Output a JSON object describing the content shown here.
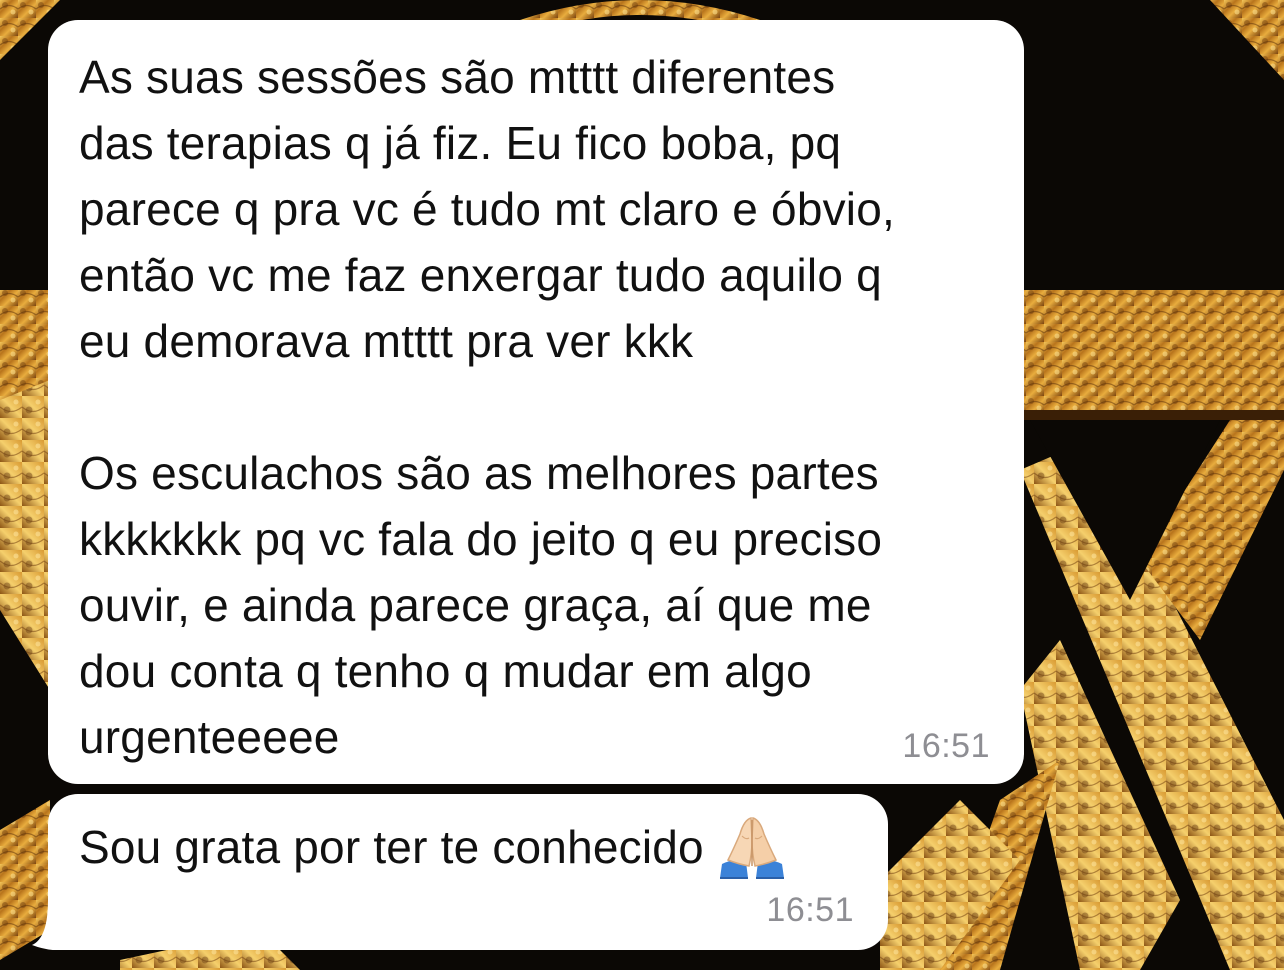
{
  "conversation": {
    "messages": [
      {
        "text": "As suas sessões são mtttt diferentes\ndas terapias q já fiz. Eu fico boba, pq\nparece q pra vc é tudo mt claro e óbvio,\nentão vc me faz enxergar tudo aquilo q\neu demorava mtttt pra ver kkk\n\nOs esculachos são as melhores partes\nkkkkkkk pq vc fala do jeito q eu preciso\nouvir, e ainda parece graça, aí que me\ndou conta q tenho q mudar em algo\nurgenteeeee",
        "time": "16:51"
      },
      {
        "text": "Sou grata por ter te conhecido",
        "emoji": "folded-hands-icon",
        "time": "16:51"
      }
    ]
  },
  "theme": {
    "bubble_color": "#ffffff",
    "text_color": "#111111",
    "time_color": "#8e8e93",
    "wallpaper_dark": "#0b0805",
    "wallpaper_gold": "#c98a2a"
  }
}
